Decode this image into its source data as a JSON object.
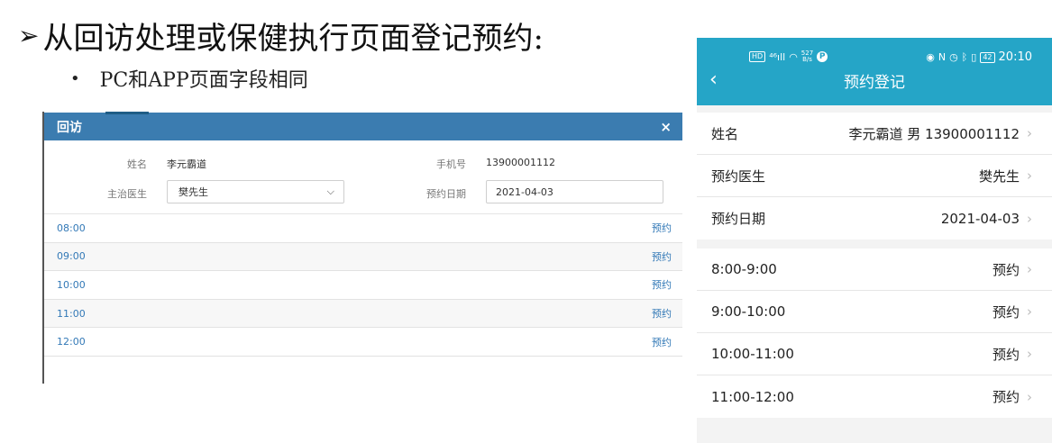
{
  "slide": {
    "title": "从回访处理或保健执行页面登记预约:",
    "bullet": "PC和APP页面字段相同"
  },
  "pc": {
    "dialog_title": "回访",
    "close_symbol": "×",
    "name_label": "姓名",
    "name_value": "李元霸道",
    "phone_label": "手机号",
    "phone_value": "13900001112",
    "doctor_label": "主治医生",
    "doctor_value": "樊先生",
    "date_label": "预约日期",
    "date_value": "2021-04-03",
    "slots": [
      {
        "time": "08:00",
        "action": "预约"
      },
      {
        "time": "09:00",
        "action": "预约"
      },
      {
        "time": "10:00",
        "action": "预约"
      },
      {
        "time": "11:00",
        "action": "预约"
      },
      {
        "time": "12:00",
        "action": "预约"
      }
    ]
  },
  "app": {
    "status": {
      "speed_top": "527",
      "speed_unit": "B/s",
      "battery": "42",
      "time": "20:10"
    },
    "nav_title": "预约登记",
    "fields": [
      {
        "label": "姓名",
        "value": "李元霸道 男 13900001112"
      },
      {
        "label": "预约医生",
        "value": "樊先生"
      },
      {
        "label": "预约日期",
        "value": "2021-04-03"
      }
    ],
    "slots": [
      {
        "time": "8:00-9:00",
        "action": "预约"
      },
      {
        "time": "9:00-10:00",
        "action": "预约"
      },
      {
        "time": "10:00-11:00",
        "action": "预约"
      },
      {
        "time": "11:00-12:00",
        "action": "预约"
      }
    ]
  },
  "colors": {
    "pc_header": "#3b7cb0",
    "app_header": "#25a5c7",
    "link": "#3379b7"
  }
}
